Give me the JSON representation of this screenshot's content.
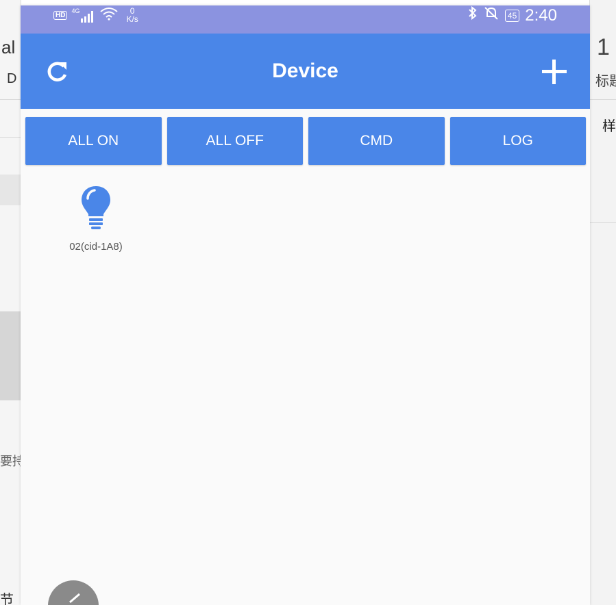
{
  "status_bar": {
    "hd": "HD",
    "signal_sup": "4G",
    "speed_value": "0",
    "speed_unit": "K/s",
    "battery": "45",
    "time": "2:40"
  },
  "app_bar": {
    "title": "Device"
  },
  "actions": [
    {
      "label": "ALL ON"
    },
    {
      "label": "ALL OFF"
    },
    {
      "label": "CMD"
    },
    {
      "label": "LOG"
    }
  ],
  "devices": [
    {
      "label": "02(cid-1A8)",
      "icon": "lightbulb-icon"
    }
  ],
  "background": {
    "left_texts": [
      "al",
      "D",
      "要持",
      "节"
    ],
    "right_texts": [
      "1",
      "标题",
      "样"
    ]
  },
  "colors": {
    "primary": "#4a86e8",
    "status_bar": "#8b93e0",
    "icon_blue": "#4a86e8"
  }
}
